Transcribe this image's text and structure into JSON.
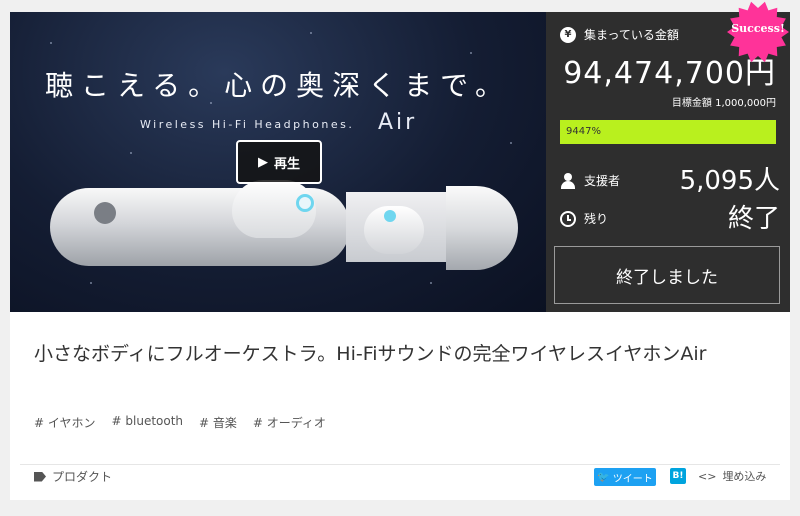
{
  "hero": {
    "headline": "聴こえる。心の奥深くまで。",
    "subtitle": "Wireless Hi-Fi Headphones.",
    "product_name": "Air",
    "play_label": "再生"
  },
  "funding": {
    "raised_label": "集まっている金額",
    "raised_amount": "94,474,700円",
    "goal_text": "目標金額 1,000,000円",
    "progress_text": "9447%",
    "progress_fraction": 1.0,
    "supporters_label": "支援者",
    "supporters_value": "5,095人",
    "remaining_label": "残り",
    "remaining_value": "終了",
    "ended_button": "終了しました",
    "badge": "Success!",
    "accent_color": "#b9f01e",
    "badge_color": "#ff3399"
  },
  "project": {
    "title": "小さなボディにフルオーケストラ。Hi-Fiサウンドの完全ワイヤレスイヤホンAir",
    "tags": [
      "# イヤホン",
      "# bluetooth",
      "# 音楽",
      "# オーディオ"
    ],
    "category": "プロダクト"
  },
  "share": {
    "tweet_label": "ツイート",
    "hatena_label": "B!",
    "embed_label": "埋め込み"
  }
}
